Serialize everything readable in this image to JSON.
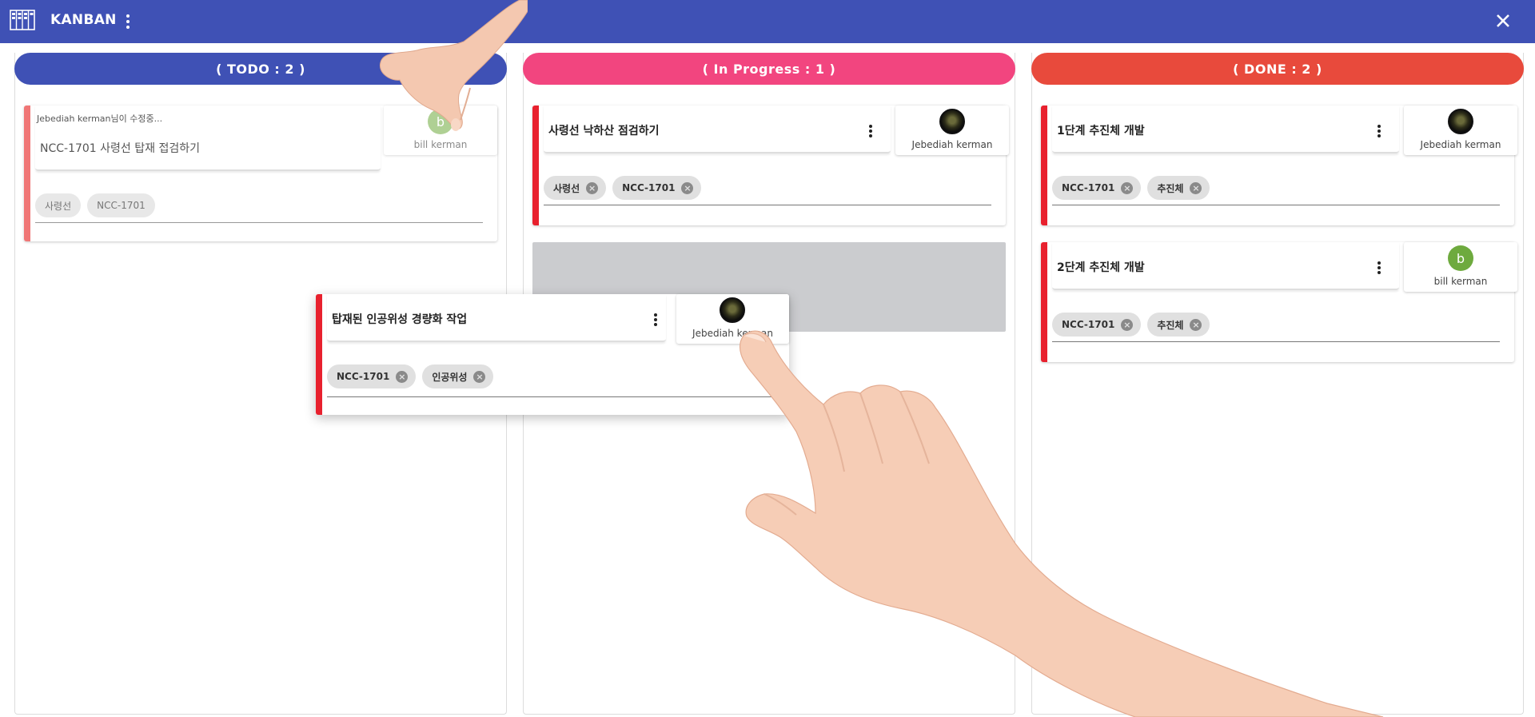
{
  "app": {
    "title": "KANBAN",
    "icon": "kanban-board-icon",
    "menu_icon": "more-vert-icon",
    "close_icon": "close-icon",
    "bar_color": "#3f51b5"
  },
  "columns": [
    {
      "header": "(   TODO : 2   )",
      "color": "#3f51b5"
    },
    {
      "header": "(   In Progress : 1   )",
      "color": "#f2457f"
    },
    {
      "header": "(   DONE : 2   )",
      "color": "#e84a3c"
    }
  ],
  "todo_edit_card": {
    "status_note": "Jebediah kerman님이 수정중...",
    "title": "NCC-1701 사령선 탑재 접검하기",
    "chips": [
      "사령선",
      "NCC-1701"
    ],
    "assignee": {
      "initial": "b",
      "name": "bill kerman"
    }
  },
  "progress_card": {
    "title": "사령선 낙하산 점검하기",
    "chips": [
      "사령선",
      "NCC-1701"
    ],
    "assignee": {
      "name": "Jebediah kerman"
    }
  },
  "dragged_card": {
    "title": "탑재된 인공위성 경량화 작업",
    "chips": [
      "NCC-1701",
      "인공위성"
    ],
    "assignee": {
      "name": "Jebediah kerman"
    }
  },
  "done_cards": [
    {
      "title": "1단계 추진체 개발",
      "chips": [
        "NCC-1701",
        "추진체"
      ],
      "assignee": {
        "name": "Jebediah kerman"
      }
    },
    {
      "title": "2단계 추진체 개발",
      "chips": [
        "NCC-1701",
        "추진체"
      ],
      "assignee": {
        "initial": "b",
        "name": "bill kerman"
      }
    }
  ],
  "colors": {
    "stripe": "#e8212e",
    "avatar_green": "#6eaa3e",
    "placeholder": "#cbcccf"
  }
}
